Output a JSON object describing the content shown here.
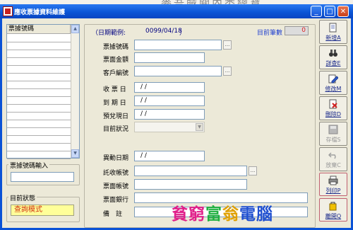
{
  "background_title": "麥吾賊關內悉總寶",
  "window": {
    "title": "應收票據資料維護"
  },
  "list": {
    "header": "票據號碼",
    "input_label": "票據號碼輸入",
    "input_value": ""
  },
  "status": {
    "label": "目前狀態",
    "value": "查詢模式"
  },
  "form": {
    "date_range_label": "（日期範例:",
    "date_range_example": "0099/04/18",
    "date_range_close": "）",
    "count_label": "目前筆數",
    "count_value": "0",
    "fields": {
      "bill_no": {
        "label": "票據號碼",
        "value": ""
      },
      "amount": {
        "label": "票面金額",
        "value": ""
      },
      "customer_no": {
        "label": "客戶編號",
        "value": ""
      },
      "receive_date": {
        "label": "收 票 日",
        "value": "/ /"
      },
      "due_date": {
        "label": "到 期 日",
        "value": "/ /"
      },
      "expected_date": {
        "label": "預兌現日",
        "value": "/ /"
      },
      "status": {
        "label": "目前狀況",
        "value": ""
      },
      "change_date": {
        "label": "異動日期",
        "value": "/ /"
      },
      "collect_account": {
        "label": "託收帳號",
        "value": ""
      },
      "bill_account": {
        "label": "票面帳號",
        "value": ""
      },
      "bill_bank": {
        "label": "票面銀行",
        "value": ""
      },
      "note": {
        "label": "備　註",
        "value": ""
      }
    }
  },
  "toolbar": {
    "add": "新增A",
    "detail": "詳查E",
    "edit": "修改M",
    "delete": "刪除D",
    "save": "存檔S",
    "cancel": "放棄C",
    "print": "列印P",
    "exit": "離開Q"
  },
  "logo": {
    "text": "貧窮富翁電腦"
  },
  "colors": {
    "window_blue": "#0a52d6",
    "status_bg": "#ffff99",
    "status_text": "#d03010",
    "count_bg": "#dcdcdc",
    "count_text": "#e02020"
  }
}
